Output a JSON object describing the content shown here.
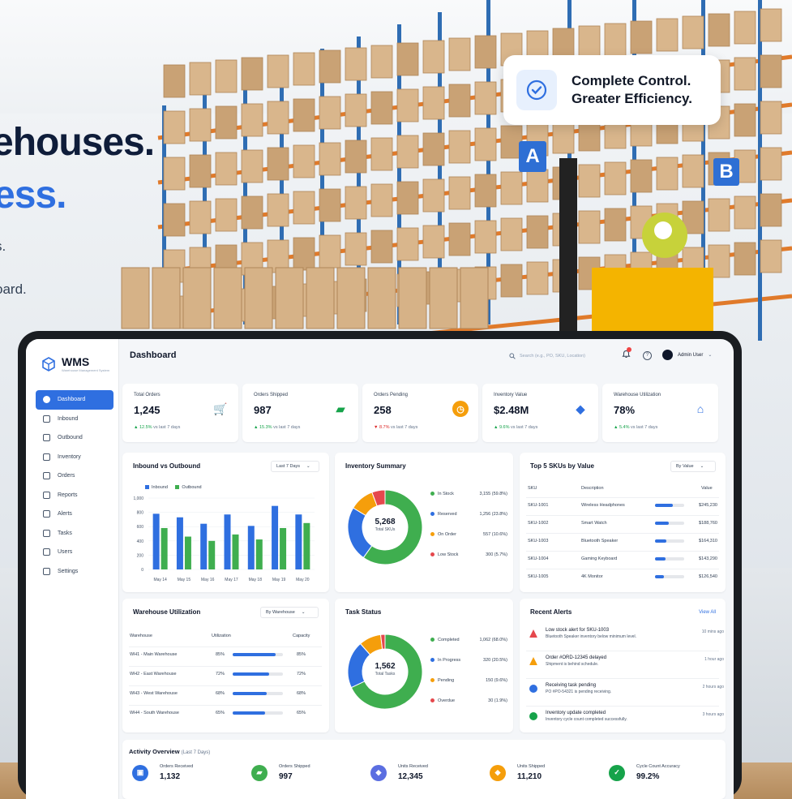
{
  "hero": {
    "line1": "ehouses.",
    "line2": "ess.",
    "line3": "s.",
    "line4": "oard."
  },
  "callout": {
    "line1": "Complete Control.",
    "line2": "Greater Efficiency.",
    "icon": "shield-check-icon"
  },
  "rack_tags": {
    "a": "A",
    "b": "B"
  },
  "app": {
    "logo": "WMS",
    "logo_sub": "Warehouse Management System",
    "page_title": "Dashboard",
    "search_placeholder": "Search (e.g., PO, SKU, Location)",
    "user_name": "Admin User",
    "nav": [
      {
        "label": "Dashboard",
        "icon": "dashboard-icon",
        "active": true
      },
      {
        "label": "Inbound",
        "icon": "inbound-icon"
      },
      {
        "label": "Outbound",
        "icon": "outbound-icon"
      },
      {
        "label": "Inventory",
        "icon": "inventory-icon"
      },
      {
        "label": "Orders",
        "icon": "orders-icon"
      },
      {
        "label": "Reports",
        "icon": "reports-icon"
      },
      {
        "label": "Alerts",
        "icon": "alerts-icon"
      },
      {
        "label": "Tasks",
        "icon": "tasks-icon"
      },
      {
        "label": "Users",
        "icon": "users-icon"
      },
      {
        "label": "Settings",
        "icon": "settings-icon"
      }
    ]
  },
  "kpis": [
    {
      "label": "Total Orders",
      "value": "1,245",
      "change": "▲ 12.5%",
      "dir": "up",
      "vs": "vs last 7 days",
      "icon": "cart-icon",
      "color": "#2f6fe0"
    },
    {
      "label": "Orders Shipped",
      "value": "987",
      "change": "▲ 15.3%",
      "dir": "up",
      "vs": "vs last 7 days",
      "icon": "truck-icon",
      "color": "#16a34a"
    },
    {
      "label": "Orders Pending",
      "value": "258",
      "change": "▼ 8.7%",
      "dir": "dn",
      "vs": "vs last 7 days",
      "icon": "clock-icon",
      "color": "#f59e0b"
    },
    {
      "label": "Inventory Value",
      "value": "$2.48M",
      "change": "▲ 9.6%",
      "dir": "up",
      "vs": "vs last 7 days",
      "icon": "tag-icon",
      "color": "#2f6fe0"
    },
    {
      "label": "Warehouse Utilization",
      "value": "78%",
      "change": "▲ 5.4%",
      "dir": "up",
      "vs": "vs last 7 days",
      "icon": "warehouse-icon",
      "color": "#2f6fe0"
    }
  ],
  "inout": {
    "title": "Inbound vs Outbound",
    "range": "Last 7 Days",
    "legend_in": "Inbound",
    "legend_out": "Outbound"
  },
  "chart_data": {
    "type": "bar",
    "categories": [
      "May 14",
      "May 15",
      "May 16",
      "May 17",
      "May 18",
      "May 19",
      "May 20"
    ],
    "series": [
      {
        "name": "Inbound",
        "values": [
          780,
          730,
          640,
          770,
          610,
          890,
          770
        ]
      },
      {
        "name": "Outbound",
        "values": [
          580,
          460,
          400,
          490,
          420,
          580,
          650
        ]
      }
    ],
    "ylim": [
      0,
      1000
    ],
    "yticks": [
      "0",
      "200",
      "400",
      "600",
      "800",
      "1,000"
    ],
    "colors": {
      "Inbound": "#2f6fe0",
      "Outbound": "#3fae4f"
    }
  },
  "inventory": {
    "title": "Inventory Summary",
    "center_value": "5,268",
    "center_label": "Total SKUs",
    "items": [
      {
        "label": "In Stock",
        "count": "3,155",
        "pct": "(59.8%)",
        "value": 59.8,
        "color": "#3fae4f"
      },
      {
        "label": "Reserved",
        "count": "1,256",
        "pct": "(23.8%)",
        "value": 23.8,
        "color": "#2f6fe0"
      },
      {
        "label": "On Order",
        "count": "557",
        "pct": "(10.6%)",
        "value": 10.6,
        "color": "#f59e0b"
      },
      {
        "label": "Low Stock",
        "count": "300",
        "pct": "(5.7%)",
        "value": 5.7,
        "color": "#e5484d"
      }
    ]
  },
  "skus": {
    "title": "Top 5 SKUs by Value",
    "sort": "By Value",
    "headers": [
      "SKU",
      "Description",
      "Value"
    ],
    "rows": [
      {
        "sku": "SKU-1001",
        "desc": "Wireless Headphones",
        "value": "$245,230",
        "ratio": 1.0
      },
      {
        "sku": "SKU-1002",
        "desc": "Smart Watch",
        "value": "$188,760",
        "ratio": 0.77
      },
      {
        "sku": "SKU-1003",
        "desc": "Bluetooth Speaker",
        "value": "$164,310",
        "ratio": 0.67
      },
      {
        "sku": "SKU-1004",
        "desc": "Gaming Keyboard",
        "value": "$143,290",
        "ratio": 0.58
      },
      {
        "sku": "SKU-1005",
        "desc": "4K Monitor",
        "value": "$126,540",
        "ratio": 0.52
      }
    ]
  },
  "util": {
    "title": "Warehouse Utilization",
    "filter": "By Warehouse",
    "headers": [
      "Warehouse",
      "Utilization",
      "Capacity"
    ],
    "rows": [
      {
        "name": "WH1 - Main Warehouse",
        "util": "85%",
        "cap": "85%",
        "value": 85
      },
      {
        "name": "WH2 - East Warehouse",
        "util": "72%",
        "cap": "72%",
        "value": 72
      },
      {
        "name": "WH3 - West Warehouse",
        "util": "68%",
        "cap": "68%",
        "value": 68
      },
      {
        "name": "WH4 - South Warehouse",
        "util": "65%",
        "cap": "65%",
        "value": 65
      }
    ]
  },
  "tasks": {
    "title": "Task Status",
    "center_value": "1,562",
    "center_label": "Total Tasks",
    "items": [
      {
        "label": "Completed",
        "count": "1,062",
        "pct": "(68.0%)",
        "value": 68.0,
        "color": "#3fae4f"
      },
      {
        "label": "In Progress",
        "count": "320",
        "pct": "(20.5%)",
        "value": 20.5,
        "color": "#2f6fe0"
      },
      {
        "label": "Pending",
        "count": "150",
        "pct": "(9.6%)",
        "value": 9.6,
        "color": "#f59e0b"
      },
      {
        "label": "Overdue",
        "count": "30",
        "pct": "(1.9%)",
        "value": 1.9,
        "color": "#e5484d"
      }
    ]
  },
  "alerts": {
    "title": "Recent Alerts",
    "view_all": "View All",
    "items": [
      {
        "title": "Low stock alert for SKU-1003",
        "sub": "Bluetooth Speaker inventory below minimum level.",
        "time": "10 mins ago",
        "color": "#e5484d",
        "icon": "warning-icon"
      },
      {
        "title": "Order #ORD-12345 delayed",
        "sub": "Shipment is behind schedule.",
        "time": "1 hour ago",
        "color": "#f59e0b",
        "icon": "warning-icon"
      },
      {
        "title": "Receiving task pending",
        "sub": "PO #PO-54321 is pending receiving.",
        "time": "2 hours ago",
        "color": "#2f6fe0",
        "icon": "info-icon"
      },
      {
        "title": "Inventory update completed",
        "sub": "Inventory cycle count completed successfully.",
        "time": "3 hours ago",
        "color": "#16a34a",
        "icon": "check-icon"
      }
    ]
  },
  "activity": {
    "title": "Activity Overview",
    "subtitle": "(Last 7 Days)",
    "items": [
      {
        "label": "Orders Received",
        "value": "1,132",
        "color": "#2f6fe0",
        "icon": "inbox-icon"
      },
      {
        "label": "Orders Shipped",
        "value": "997",
        "color": "#3fae4f",
        "icon": "truck-icon"
      },
      {
        "label": "Units Received",
        "value": "12,345",
        "color": "#5b6ee1",
        "icon": "box-icon"
      },
      {
        "label": "Units Shipped",
        "value": "11,210",
        "color": "#f59e0b",
        "icon": "box-icon"
      },
      {
        "label": "Cycle Count Accuracy",
        "value": "99.2%",
        "color": "#16a34a",
        "icon": "shield-check-icon"
      }
    ]
  }
}
